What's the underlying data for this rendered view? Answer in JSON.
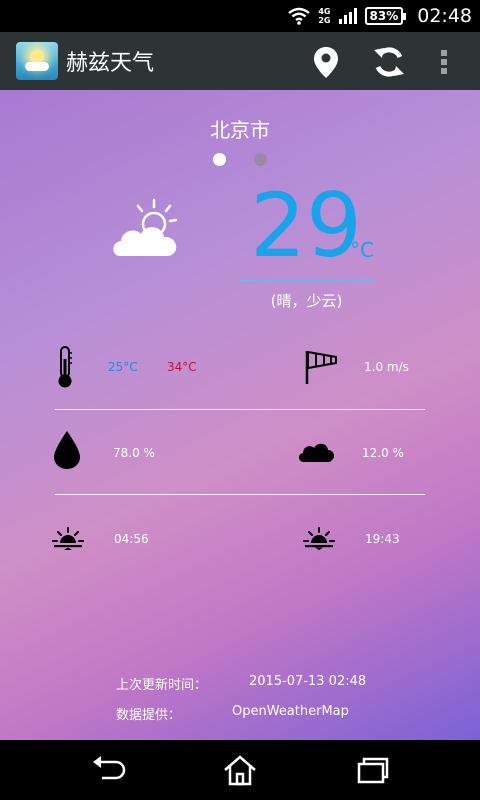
{
  "status_bar": {
    "net_top": "4G",
    "net_bottom": "2G",
    "battery": "83%",
    "time": "02:48"
  },
  "action_bar": {
    "title": "赫兹天气",
    "icons": [
      "location-pin-icon",
      "refresh-icon",
      "overflow-menu-icon"
    ]
  },
  "weather": {
    "city": "北京市",
    "temperature": "29",
    "unit": "°C",
    "description": "(晴，少云)",
    "condition_icon": "sun-behind-cloud-icon",
    "temp_min": "25°C",
    "temp_max": "34°C",
    "wind": "1.0 m/s",
    "humidity": "78.0 %",
    "clouds": "12.0 %",
    "sunrise": "04:56",
    "sunset": "19:43"
  },
  "footer": {
    "updated_label": "上次更新时间：",
    "updated_value": "2015-07-13 02:48",
    "provider_label": "数据提供：",
    "provider_value": "OpenWeatherMap"
  },
  "colors": {
    "temp_blue": "#1aa3e8",
    "min_blue": "#1e8fe0",
    "max_red": "#c8102e"
  },
  "nav_bar": {
    "icons": [
      "back-icon",
      "home-icon",
      "recent-apps-icon"
    ]
  }
}
